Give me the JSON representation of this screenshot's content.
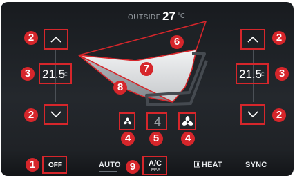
{
  "outside": {
    "label": "OUTSIDE",
    "value": "27",
    "unit": "°C"
  },
  "left": {
    "temp": "21.5",
    "unit": "°C"
  },
  "right": {
    "temp": "21.5",
    "unit": "°C"
  },
  "fan_speed": "4",
  "buttons": {
    "off": "OFF",
    "auto": "AUTO",
    "ac": "A/C",
    "ac_sub": "MAX",
    "heat": "HEAT",
    "sync": "SYNC"
  },
  "callouts": {
    "off": "1",
    "temp_up_left": "2",
    "temp_up_right": "2",
    "temp_down_left": "2",
    "temp_down_right": "2",
    "temp_left": "3",
    "temp_right": "3",
    "fan_down": "4",
    "fan_up": "4",
    "fan_level": "5",
    "airflow_top": "6",
    "airflow_mid": "7",
    "airflow_low": "8",
    "ac": "9"
  },
  "colors": {
    "callout": "#d6262b",
    "panel": "#202327",
    "text": "#ffffff"
  },
  "icons": [
    "chevron-up-icon",
    "chevron-down-icon",
    "fan-icon",
    "seat-airflow-icon",
    "rear-defrost-icon"
  ]
}
